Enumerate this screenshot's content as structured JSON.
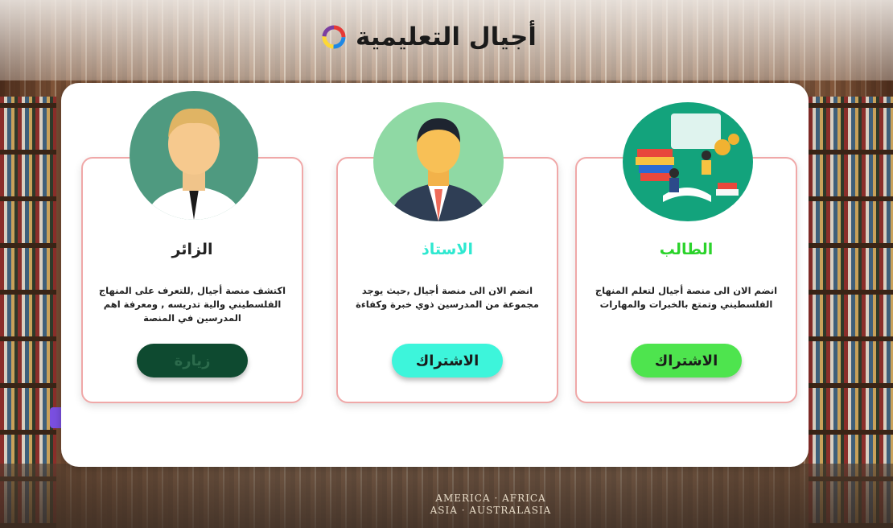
{
  "brand": {
    "name": "أجيال التعليمية"
  },
  "background": {
    "floor_sign_line1": "AMERICA · AFRICA",
    "floor_sign_line2": "ASIA · AUSTRALASIA"
  },
  "colors": {
    "student_title": "#2bd32b",
    "teacher_title": "#2ee8d0",
    "visitor_title": "#222222",
    "student_button": "#4ee44e",
    "teacher_button": "#3df5db",
    "visitor_button": "#0e4a30"
  },
  "cards": [
    {
      "role": "student",
      "title": "الطالب",
      "description": "انضم الان الى منصة أجيال لتعلم المنهاج الفلسطيني وتمتع بالخبرات والمهارات",
      "button_label": "الاشتراك",
      "image_icon": "students-learning-illustration-icon"
    },
    {
      "role": "teacher",
      "title": "الاستاذ",
      "description": "انضم الان الى منصة أجيال ,حيث يوجد مجموعة من المدرسين ذوي خبرة وكفاءة",
      "button_label": "الاشتراك",
      "image_icon": "teacher-avatar-icon"
    },
    {
      "role": "visitor",
      "title": "الزائر",
      "description": "اكتشف منصة أجيال ,للتعرف على المنهاج الفلسطيني والية تدريسه , ومعرفة اهم المدرسين في المنصة",
      "button_label": "زيارة",
      "image_icon": "visitor-avatar-icon"
    }
  ]
}
